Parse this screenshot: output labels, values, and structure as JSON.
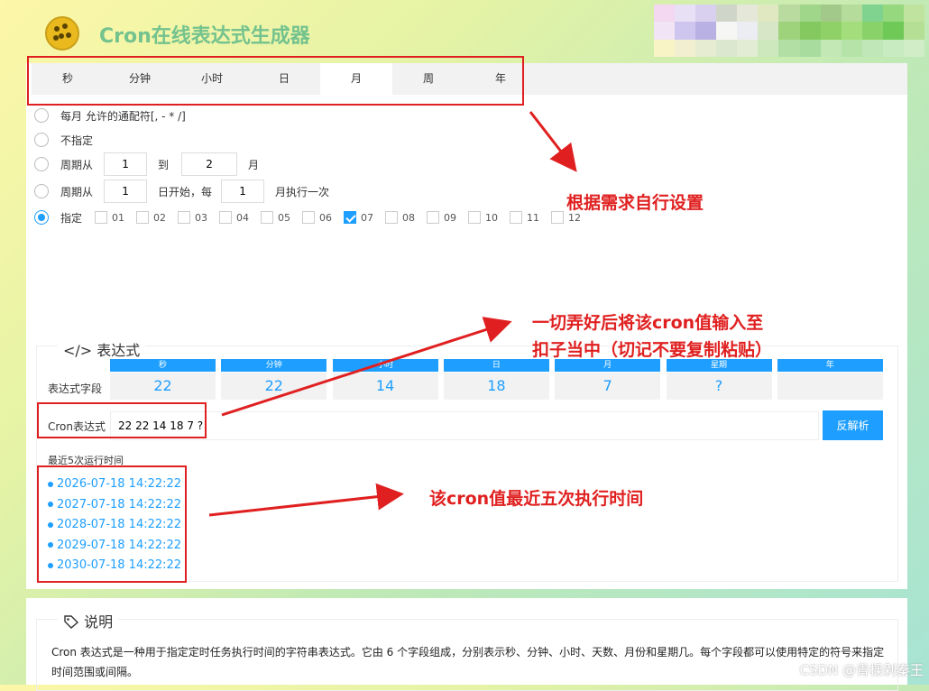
{
  "header": {
    "title": "Cron在线表达式生成器"
  },
  "tabs": [
    "秒",
    "分钟",
    "小时",
    "日",
    "月",
    "周",
    "年"
  ],
  "month_options": {
    "option1": "每月 允许的通配符[, - * /]",
    "option2": "不指定",
    "option3": {
      "prefix": "周期从",
      "from": "1",
      "mid": "到",
      "to": "2",
      "suffix": "月"
    },
    "option4": {
      "prefix": "周期从",
      "start": "1",
      "mid": "日开始，每",
      "step": "1",
      "suffix": "月执行一次"
    },
    "option5": {
      "prefix": "指定",
      "months": [
        "01",
        "02",
        "03",
        "04",
        "05",
        "06",
        "07",
        "08",
        "09",
        "10",
        "11",
        "12"
      ],
      "checked": [
        "07"
      ]
    }
  },
  "expression": {
    "legend": "表达式",
    "field_label": "表达式字段",
    "fields": [
      {
        "head": "秒",
        "value": "22"
      },
      {
        "head": "分钟",
        "value": "22"
      },
      {
        "head": "小时",
        "value": "14"
      },
      {
        "head": "日",
        "value": "18"
      },
      {
        "head": "月",
        "value": "7"
      },
      {
        "head": "星期",
        "value": "?"
      },
      {
        "head": "年",
        "value": ""
      }
    ],
    "cron_label": "Cron表达式",
    "cron_value": "22 22 14 18 7 ?",
    "parse_button": "反解析",
    "runs_title": "最近5次运行时间",
    "runs": [
      "2026-07-18 14:22:22",
      "2027-07-18 14:22:22",
      "2028-07-18 14:22:22",
      "2029-07-18 14:22:22",
      "2030-07-18 14:22:22"
    ]
  },
  "notes": {
    "legend": "说明",
    "text": "Cron 表达式是一种用于指定定时任务执行时间的字符串表达式。它由 6 个字段组成，分别表示秒、分钟、小时、天数、月份和星期几。每个字段都可以使用特定的符号来指定时间范围或间隔。"
  },
  "annotations": {
    "settings": "根据需求自行设置",
    "input_line1": "一切弄好后将该cron值输入至",
    "input_line2": "扣子当中（切记不要复制粘贴）",
    "runs": "该cron值最近五次执行时间"
  },
  "watermark": "CSDN @青棵剁秦王",
  "colors": {
    "accent": "#1e9fff",
    "annotation": "#e02020",
    "title": "#74c28e"
  }
}
